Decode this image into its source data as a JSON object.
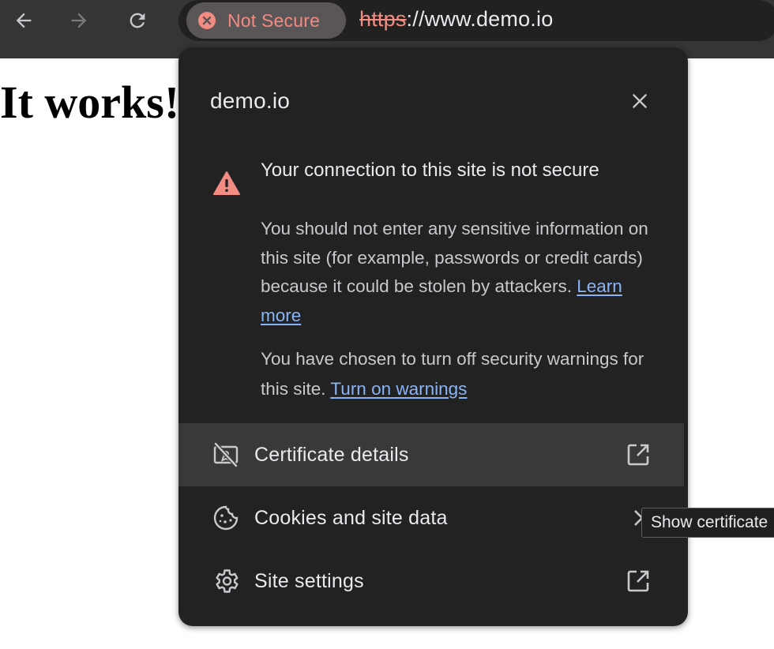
{
  "browser": {
    "security_chip_label": "Not Secure",
    "url_scheme": "https",
    "url_rest": "://www.demo.io"
  },
  "page": {
    "heading": "It works!"
  },
  "site_info": {
    "title": "demo.io",
    "warning_heading": "Your connection to this site is not secure",
    "warning_body": "You should not enter any sensitive information on this site (for example, passwords or credit cards) because it could be stolen by attackers.",
    "learn_more": "Learn more",
    "warnings_off_text": "You have chosen to turn off security warnings for this site.",
    "turn_on_warnings": "Turn on warnings",
    "items": [
      {
        "label": "Certificate details",
        "icon": "certificate-off-icon",
        "end_icon": "external-link-icon"
      },
      {
        "label": "Cookies and site data",
        "icon": "cookie-icon",
        "end_icon": "chevron-right-icon"
      },
      {
        "label": "Site settings",
        "icon": "gear-icon",
        "end_icon": "external-link-icon"
      }
    ]
  },
  "tooltip": {
    "text": "Show certificate"
  },
  "colors": {
    "toolbar": "#353535",
    "omnibox": "#212121",
    "popup": "#222222",
    "danger": "#f28b82",
    "link": "#8ab4f8"
  }
}
